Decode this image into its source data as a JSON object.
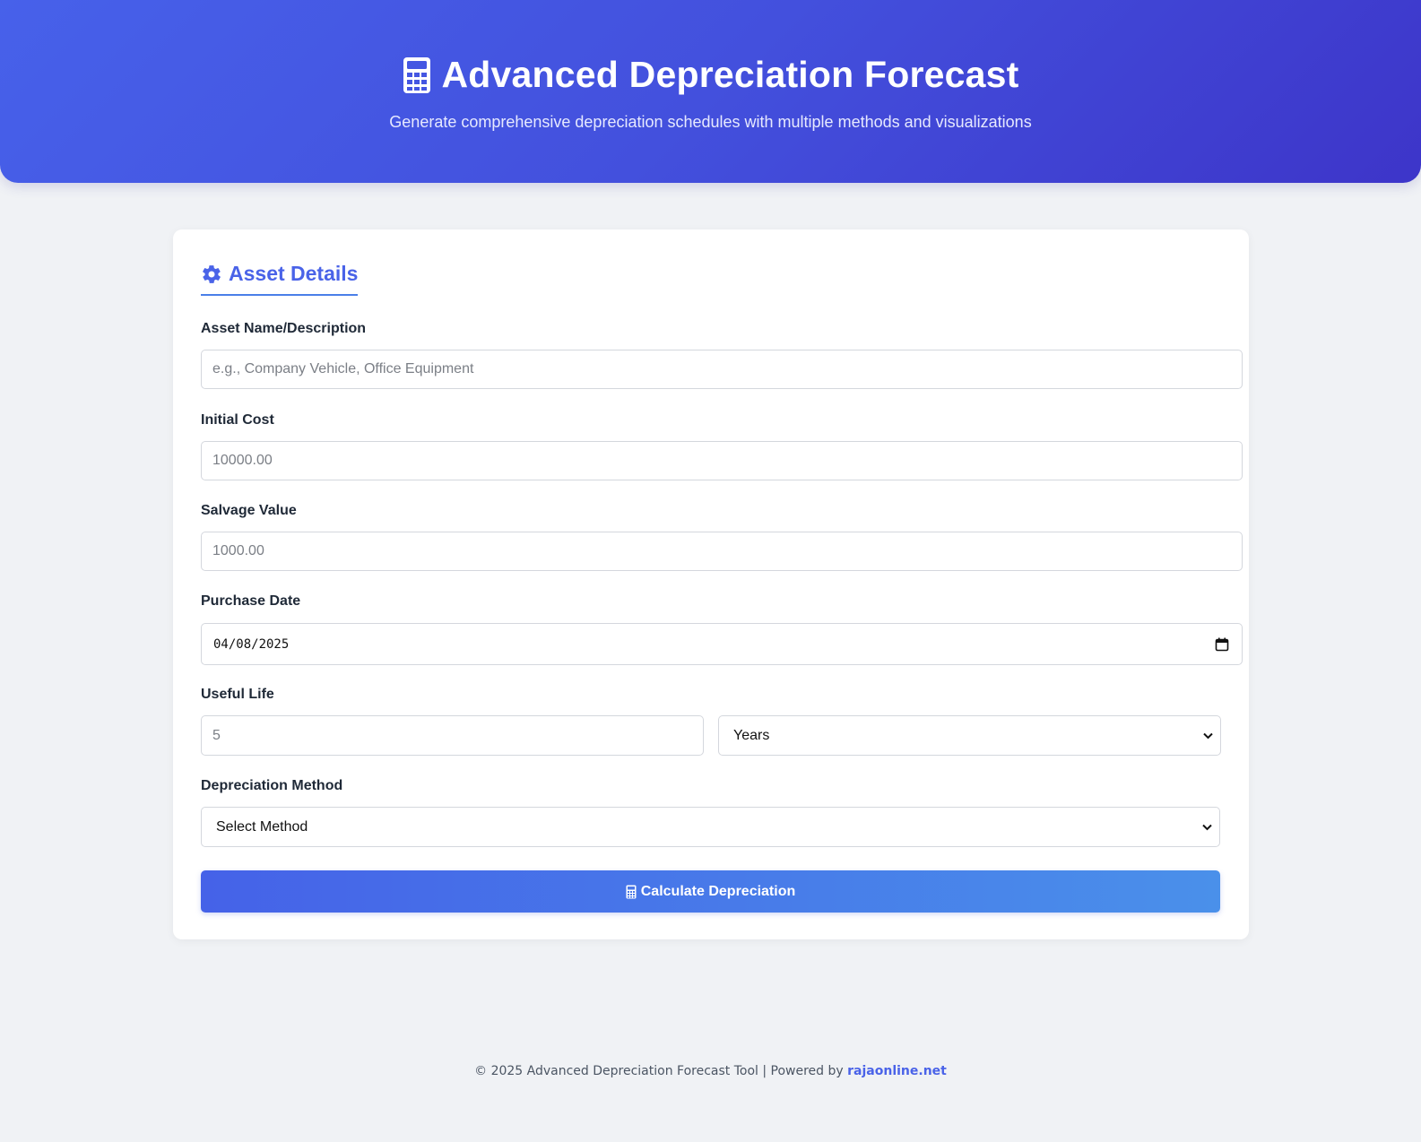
{
  "header": {
    "title": "Advanced Depreciation Forecast",
    "subtitle": "Generate comprehensive depreciation schedules with multiple methods and visualizations",
    "icon": "calculator-icon"
  },
  "form": {
    "section_title": "Asset Details",
    "section_icon": "gear-icon",
    "asset_name": {
      "label": "Asset Name/Description",
      "placeholder": "e.g., Company Vehicle, Office Equipment",
      "value": ""
    },
    "initial_cost": {
      "label": "Initial Cost",
      "placeholder": "10000.00",
      "value": ""
    },
    "salvage_value": {
      "label": "Salvage Value",
      "placeholder": "1000.00",
      "value": ""
    },
    "purchase_date": {
      "label": "Purchase Date",
      "value": "04/08/2025",
      "icon": "calendar-icon"
    },
    "useful_life": {
      "label": "Useful Life",
      "placeholder": "5",
      "value": "",
      "unit_selected": "Years"
    },
    "method": {
      "label": "Depreciation Method",
      "selected": "Select Method"
    },
    "submit_label": "Calculate Depreciation"
  },
  "footer": {
    "text": "© 2025 Advanced Depreciation Forecast Tool | Powered by ",
    "link": "rajaonline.net"
  },
  "colors": {
    "hero_gradient_start": "#4761ea",
    "hero_gradient_end": "#3d35c9",
    "accent": "#4a63e8",
    "button_gradient_end": "#4a90ea",
    "page_background": "#f0f2f5"
  }
}
